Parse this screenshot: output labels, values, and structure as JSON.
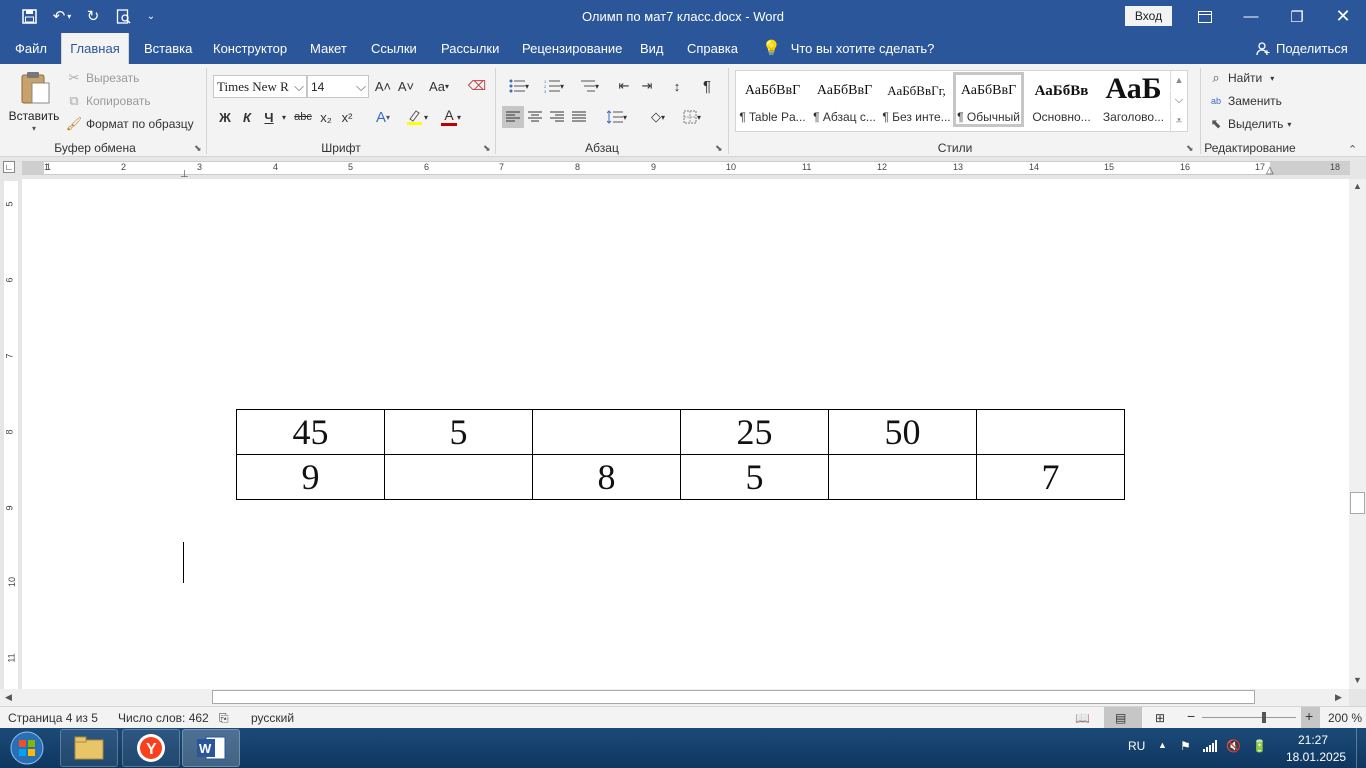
{
  "titlebar": {
    "document_title": "Олимп по мат7 класс.docx  -  Word",
    "login_label": "Вход"
  },
  "tabs": [
    "Файл",
    "Главная",
    "Вставка",
    "Конструктор",
    "Макет",
    "Ссылки",
    "Рассылки",
    "Рецензирование",
    "Вид",
    "Справка"
  ],
  "tell_me": "Что вы хотите сделать?",
  "share_label": "Поделиться",
  "clipboard": {
    "paste": "Вставить",
    "cut": "Вырезать",
    "copy": "Копировать",
    "format_painter": "Формат по образцу",
    "group_label": "Буфер обмена"
  },
  "font": {
    "name": "Times New R",
    "size": "14",
    "group_label": "Шрифт",
    "bold": "Ж",
    "italic": "К",
    "underline": "Ч",
    "strike": "abc",
    "subscript": "x₂",
    "superscript": "x²",
    "grow": "A˄",
    "shrink": "A˅",
    "change_case": "Aa",
    "font_color": "#c00000",
    "highlight_color": "#ffff00"
  },
  "paragraph": {
    "group_label": "Абзац"
  },
  "styles": {
    "group_label": "Стили",
    "items": [
      {
        "sample": "АаБбВвГ",
        "name": "¶ Table Pa..."
      },
      {
        "sample": "АаБбВвГ",
        "name": "¶ Абзац с..."
      },
      {
        "sample": "АаБбВвГг,",
        "name": "¶ Без инте..."
      },
      {
        "sample": "АаБбВвГ",
        "name": "¶ Обычный"
      },
      {
        "sample": "АаБбВв",
        "name": "Основно..."
      },
      {
        "sample": "АаБ",
        "name": "Заголово..."
      }
    ]
  },
  "editing": {
    "group_label": "Редактирование",
    "find": "Найти",
    "replace": "Заменить",
    "select": "Выделить"
  },
  "ruler": {
    "h_numbers": [
      "1",
      "1",
      "2",
      "3",
      "4",
      "5",
      "6",
      "7",
      "8",
      "9",
      "10",
      "11",
      "12",
      "13",
      "14",
      "15",
      "16",
      "17",
      "18"
    ],
    "v_numbers": [
      "5",
      "6",
      "7",
      "8",
      "9",
      "10",
      "11"
    ]
  },
  "table": {
    "rows": [
      [
        "45",
        "5",
        "",
        "25",
        "50",
        ""
      ],
      [
        "9",
        "",
        "8",
        "5",
        "",
        "7"
      ]
    ]
  },
  "status": {
    "page": "Страница 4 из 5",
    "words": "Число слов: 462",
    "language": "русский",
    "zoom": "200 %"
  },
  "taskbar": {
    "lang": "RU",
    "time": "21:27",
    "date": "18.01.2025"
  },
  "colors": {
    "word_blue": "#2b579a",
    "ribbon_bg": "#f3f3f3"
  }
}
